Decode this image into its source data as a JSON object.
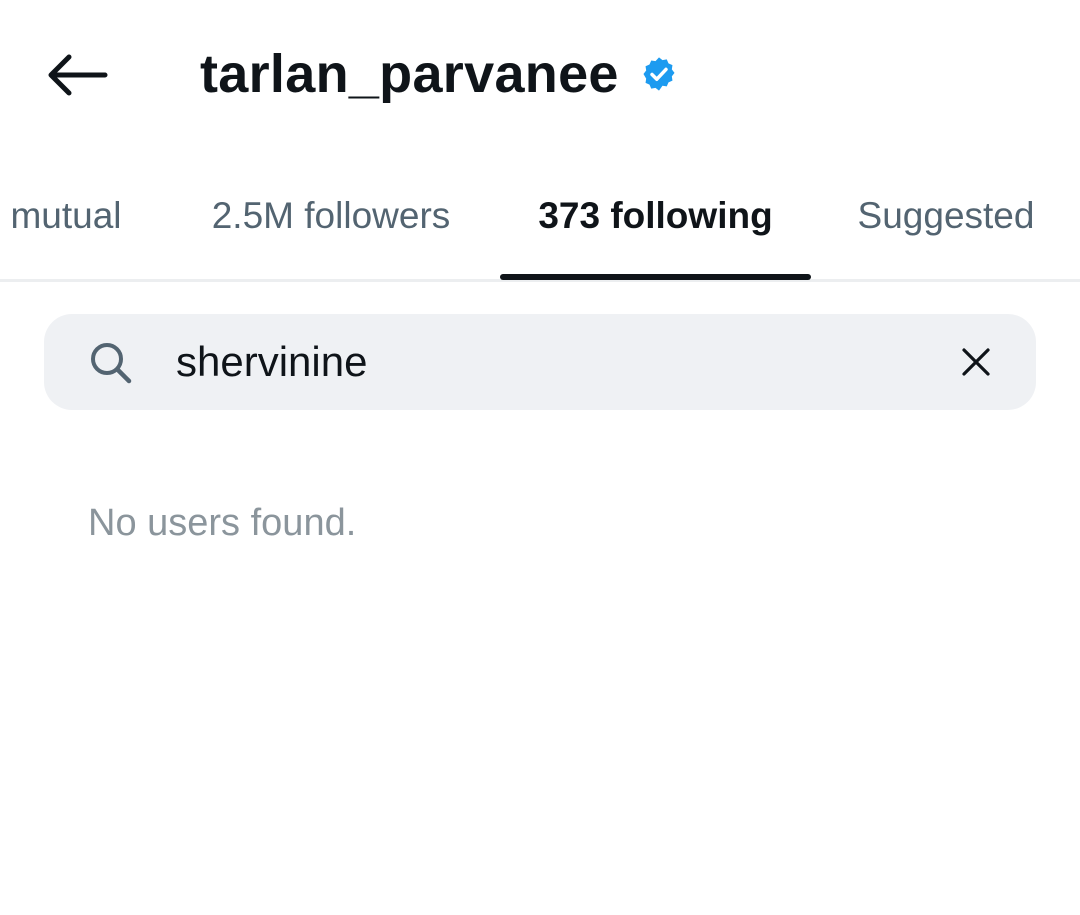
{
  "header": {
    "back_icon": "arrow-left-icon",
    "title": "tarlan_parvanee",
    "verified_icon": "verified-badge-icon",
    "verified_color": "#1d9bf0"
  },
  "tabs": [
    {
      "label": "mutual",
      "active": false
    },
    {
      "label": "2.5M followers",
      "active": false
    },
    {
      "label": "373 following",
      "active": true
    },
    {
      "label": "Suggested",
      "active": false
    }
  ],
  "search": {
    "icon": "search-icon",
    "value": "shervinine",
    "clear_icon": "close-icon"
  },
  "results": {
    "empty_message": "No users found."
  },
  "colors": {
    "text_primary": "#0f1419",
    "text_secondary": "#536471",
    "search_bg": "#eff1f4",
    "empty_text": "#8b959c"
  }
}
